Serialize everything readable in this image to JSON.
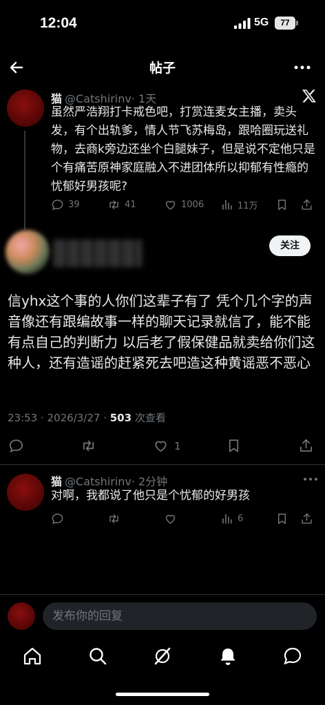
{
  "status_bar": {
    "time": "12:04",
    "network": "5G",
    "battery": "77"
  },
  "navbar": {
    "title": "帖子"
  },
  "parent_post": {
    "name": "猫",
    "handle": "@Catshirinv",
    "age": "· 1天",
    "text": "虽然严浩翔打卡戒色吧，打赏连麦女主播，卖头发，有个出轨爹，情人节飞苏梅岛，跟哈圈玩送礼物，去商k旁边还坐个白腿妹子，但是说不定他只是个有痛苦原神家庭融入不进团体所以抑郁有性瘾的忧郁好男孩呢?",
    "replies": "39",
    "reposts": "41",
    "likes": "1006",
    "views": "11万"
  },
  "main_post": {
    "follow_label": "关注",
    "text": "信yhx这个事的人你们这辈子有了 凭个几个字的声音像还有跟编故事一样的聊天记录就信了，能不能有点自己的判断力 以后老了假保健品就卖给你们这种人，还有造谣的赶紧死去吧造这种黄谣恶不恶心",
    "timestamp": "23:53 · 2026/3/27 · ",
    "views": "503",
    "views_label": " 次查看",
    "likes": "1"
  },
  "reply": {
    "name": "猫",
    "handle": "@Catshirinv",
    "age": "· 2分钟",
    "text": "对啊，我都说了他只是个忧郁的好男孩",
    "views": "6"
  },
  "compose": {
    "placeholder": "发布你的回复"
  },
  "colors": {
    "background": "#000000",
    "text": "#e7e9ea",
    "muted": "#71767b",
    "avatar": "#7a0a0a"
  },
  "icons": [
    "back-arrow-icon",
    "more-icon",
    "x-logo-icon",
    "reply-icon",
    "repost-icon",
    "like-icon",
    "views-icon",
    "bookmark-icon",
    "share-icon",
    "home-icon",
    "search-icon",
    "grok-icon",
    "notifications-icon",
    "messages-icon"
  ]
}
